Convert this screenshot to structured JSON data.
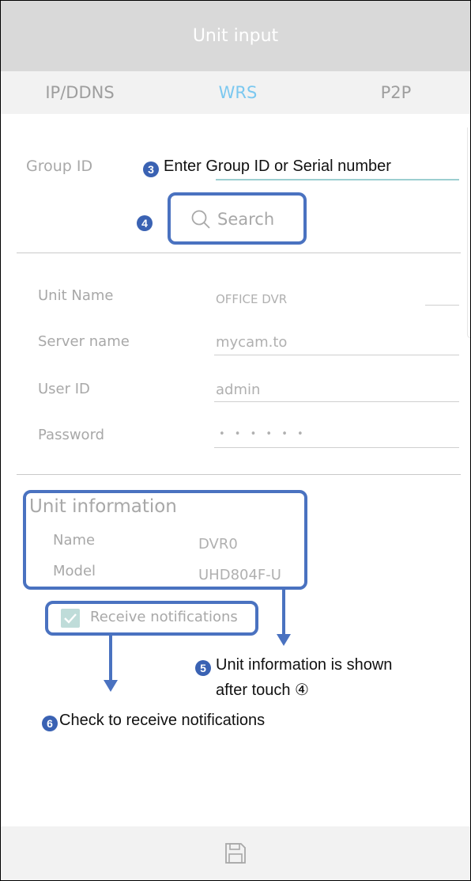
{
  "window": {
    "title": "Unit input"
  },
  "tabs": [
    {
      "label": "IP/DDNS",
      "active": false
    },
    {
      "label": "WRS",
      "active": true
    },
    {
      "label": "P2P",
      "active": false
    }
  ],
  "group": {
    "label": "Group ID",
    "annotation_badge": "3",
    "annotation": "Enter Group ID or Serial number"
  },
  "search": {
    "annotation_badge": "4",
    "label": "Search"
  },
  "fields": [
    {
      "label": "Unit Name",
      "value": "OFFICE DVR"
    },
    {
      "label": "Server name",
      "value": "mycam.to"
    },
    {
      "label": "User ID",
      "value": "admin"
    },
    {
      "label": "Password",
      "value": "• • • • • •"
    }
  ],
  "unit_info": {
    "heading": "Unit information",
    "name_label": "Name",
    "name_value": "DVR0",
    "model_label": "Model",
    "model_value": "UHD804F-U"
  },
  "notifications": {
    "label": "Receive notifications",
    "checked": true
  },
  "annotations": {
    "five_badge": "5",
    "five_line1": "Unit information is shown",
    "five_line2": "after touch ④",
    "six_badge": "6",
    "six_text": "Check to receive notifications"
  },
  "icons": {
    "save": "floppy-disk-icon",
    "search": "magnifier-icon",
    "check": "checkmark-icon"
  },
  "colors": {
    "annotation_box": "#4a72c0",
    "active_tab": "#7bc8f0",
    "badge": "#3a62b3",
    "checkbox": "#bfdcd9"
  }
}
